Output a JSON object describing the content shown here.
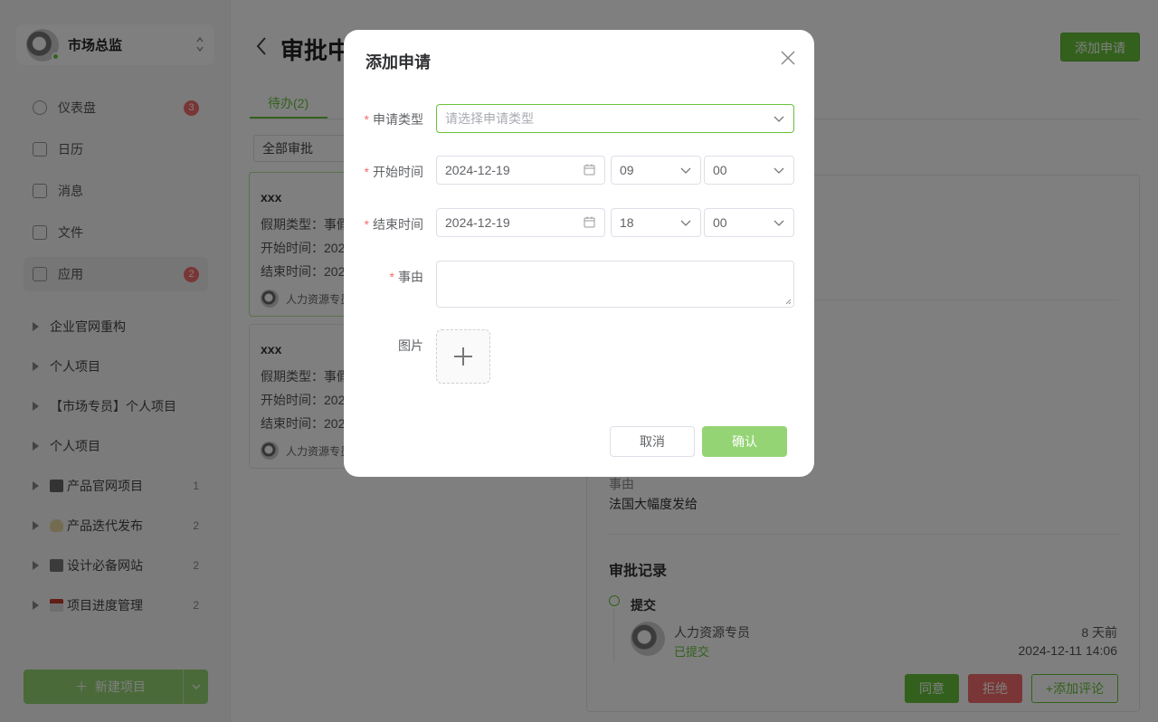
{
  "sidebar": {
    "user_name": "市场总监",
    "nav": [
      {
        "label": "仪表盘",
        "badge": "3",
        "icon": "dashboard-icon"
      },
      {
        "label": "日历",
        "icon": "calendar-icon"
      },
      {
        "label": "消息",
        "icon": "message-icon"
      },
      {
        "label": "文件",
        "icon": "file-icon"
      },
      {
        "label": "应用",
        "badge": "2",
        "icon": "apps-icon"
      }
    ],
    "projects": [
      {
        "label": "企业官网重构",
        "count": ""
      },
      {
        "label": "个人项目",
        "count": ""
      },
      {
        "label": "【市场专员】个人项目",
        "count": ""
      },
      {
        "label": "个人项目",
        "count": ""
      },
      {
        "label": "产品官网项目",
        "count": "1",
        "emoji": "building-icon"
      },
      {
        "label": "产品迭代发布",
        "count": "2",
        "emoji": "lightbulb-icon"
      },
      {
        "label": "设计必备网站",
        "count": "2",
        "emoji": "printer-icon"
      },
      {
        "label": "项目进度管理",
        "count": "2",
        "emoji": "calendar-tear-icon"
      }
    ],
    "new_project_label": "新建项目"
  },
  "main": {
    "title": "审批中",
    "add_button": "添加申请",
    "tab_pending": "待办(2)",
    "filter_value": "全部审批",
    "cards": [
      {
        "title": "xxx",
        "type_line": "假期类型：事假",
        "start_line": "开始时间：202",
        "end_line": "结束时间：202",
        "owner": "人力资源专员"
      },
      {
        "title": "xxx",
        "type_line": "假期类型：事假",
        "start_line": "开始时间：202",
        "end_line": "结束时间：202",
        "owner": "人力资源专员"
      }
    ],
    "detail": {
      "reason_label": "事由",
      "reason_value": "法国大幅度发给",
      "records_title": "审批记录",
      "record": {
        "step": "提交",
        "name": "人力资源专员",
        "status": "已提交",
        "ago": "8 天前",
        "time": "2024-12-11 14:06"
      },
      "approve": "同意",
      "reject": "拒绝",
      "comment": "+添加评论"
    }
  },
  "dialog": {
    "title": "添加申请",
    "type_label": "申请类型",
    "type_placeholder": "请选择申请类型",
    "start_label": "开始时间",
    "start_date": "2024-12-19",
    "start_hour": "09",
    "start_minute": "00",
    "end_label": "结束时间",
    "end_date": "2024-12-19",
    "end_hour": "18",
    "end_minute": "00",
    "reason_label": "事由",
    "image_label": "图片",
    "cancel": "取消",
    "confirm": "确认",
    "required_mark": "*"
  },
  "colors": {
    "primary": "#67c23a",
    "primary_light": "#95d475",
    "danger": "#f56c6c"
  }
}
